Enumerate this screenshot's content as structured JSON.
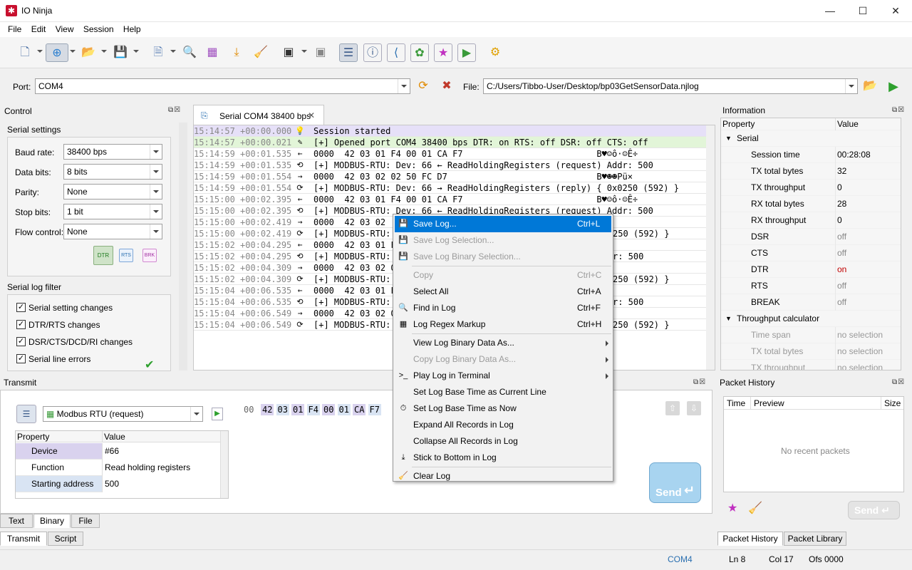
{
  "app": {
    "title": "IO Ninja"
  },
  "menu": [
    "File",
    "Edit",
    "View",
    "Session",
    "Help"
  ],
  "port": {
    "label": "Port:",
    "value": "COM4",
    "file_label": "File:",
    "file_value": "C:/Users/Tibbo-User/Desktop/bp03GetSensorData.njlog"
  },
  "control": {
    "title": "Control",
    "serial_settings": "Serial settings",
    "fields": [
      {
        "label": "Baud rate:",
        "value": "38400 bps"
      },
      {
        "label": "Data bits:",
        "value": "8 bits"
      },
      {
        "label": "Parity:",
        "value": "None"
      },
      {
        "label": "Stop bits:",
        "value": "1 bit"
      },
      {
        "label": "Flow control:",
        "value": "None"
      }
    ],
    "pins": [
      "DTR",
      "RTS",
      "BRK"
    ],
    "filter_title": "Serial log filter",
    "filters": [
      "Serial setting changes",
      "DTR/RTS changes",
      "DSR/CTS/DCD/RI changes",
      "Serial line errors"
    ]
  },
  "session_tab": {
    "label": "Serial COM4 38400 bps"
  },
  "log": [
    {
      "ts": "15:14:57 +00:00.000",
      "icon": "💡",
      "text": "Session started",
      "bg": "#e6e0f8"
    },
    {
      "ts": "15:14:57 +00:00.021",
      "icon": "✎",
      "text": "[+] Opened port COM4 38400 bps DTR: on RTS: off DSR: off CTS: off",
      "bg": "#e2f5d8"
    },
    {
      "ts": "15:14:59 +00:01.535",
      "icon": "←",
      "text": "0000  42 03 01 F4 00 01 CA F7                          B♥☺ô·☺Ê÷",
      "bg": "#ffffff"
    },
    {
      "ts": "15:14:59 +00:01.535",
      "icon": "⟲",
      "text": "[+] MODBUS-RTU: Dev: 66 ← ReadHoldingRegisters (request) Addr: 500",
      "bg": "#ffffff"
    },
    {
      "ts": "15:14:59 +00:01.554",
      "icon": "→",
      "text": "0000  42 03 02 02 50 FC D7                             B♥☻☻Pü×",
      "bg": "#ffffff"
    },
    {
      "ts": "15:14:59 +00:01.554",
      "icon": "⟳",
      "text": "[+] MODBUS-RTU: Dev: 66 → ReadHoldingRegisters (reply) { 0x0250 (592) }",
      "bg": "#ffffff"
    },
    {
      "ts": "15:15:00 +00:02.395",
      "icon": "←",
      "text": "0000  42 03 01 F4 00 01 CA F7                          B♥☺ô·☺Ê÷",
      "bg": "#ffffff"
    },
    {
      "ts": "15:15:00 +00:02.395",
      "icon": "⟲",
      "text": "[+] MODBUS-RTU: Dev: 66 ← ReadHoldingRegisters (request) Addr: 500",
      "bg": "#ffffff"
    },
    {
      "ts": "15:15:00 +00:02.419",
      "icon": "→",
      "text": "0000  42 03 02",
      "bg": "#ffffff"
    },
    {
      "ts": "15:15:00 +00:02.419",
      "icon": "⟳",
      "text": "[+] MODBUS-RTU:",
      "bg": "#ffffff",
      "tail": "250 (592) }"
    },
    {
      "ts": "15:15:02 +00:04.295",
      "icon": "←",
      "text": "0000  42 03 01 F",
      "bg": "#ffffff"
    },
    {
      "ts": "15:15:02 +00:04.295",
      "icon": "⟲",
      "text": "[+] MODBUS-RTU:",
      "bg": "#ffffff",
      "tail": "r: 500"
    },
    {
      "ts": "15:15:02 +00:04.309",
      "icon": "→",
      "text": "0000  42 03 02 0",
      "bg": "#ffffff"
    },
    {
      "ts": "15:15:02 +00:04.309",
      "icon": "⟳",
      "text": "[+] MODBUS-RTU:",
      "bg": "#ffffff",
      "tail": "250 (592) }"
    },
    {
      "ts": "15:15:04 +00:06.535",
      "icon": "←",
      "text": "0000  42 03 01 F",
      "bg": "#ffffff"
    },
    {
      "ts": "15:15:04 +00:06.535",
      "icon": "⟲",
      "text": "[+] MODBUS-RTU:",
      "bg": "#ffffff",
      "tail": "r: 500"
    },
    {
      "ts": "15:15:04 +00:06.549",
      "icon": "→",
      "text": "0000  42 03 02 0",
      "bg": "#ffffff"
    },
    {
      "ts": "15:15:04 +00:06.549",
      "icon": "⟳",
      "text": "[+] MODBUS-RTU:",
      "bg": "#ffffff",
      "tail": "250 (592) }"
    }
  ],
  "context_menu": [
    {
      "label": "Save Log...",
      "shortcut": "Ctrl+L",
      "icon": "💾",
      "state": "selected"
    },
    {
      "label": "Save Log Selection...",
      "shortcut": "",
      "icon": "💾",
      "state": "disabled"
    },
    {
      "label": "Save Log Binary Selection...",
      "shortcut": "",
      "icon": "💾",
      "state": "disabled"
    },
    {
      "sep": true
    },
    {
      "label": "Copy",
      "shortcut": "Ctrl+C",
      "icon": "",
      "state": "disabled"
    },
    {
      "label": "Select All",
      "shortcut": "Ctrl+A",
      "icon": "",
      "state": "normal"
    },
    {
      "label": "Find in Log",
      "shortcut": "Ctrl+F",
      "icon": "🔍",
      "state": "normal"
    },
    {
      "label": "Log Regex Markup",
      "shortcut": "Ctrl+H",
      "icon": "▦",
      "state": "normal"
    },
    {
      "sep": true
    },
    {
      "label": "View Log Binary Data As...",
      "shortcut": "",
      "icon": "",
      "state": "normal",
      "submenu": true
    },
    {
      "label": "Copy Log Binary Data As...",
      "shortcut": "",
      "icon": "",
      "state": "disabled",
      "submenu": true
    },
    {
      "label": "Play Log in Terminal",
      "shortcut": "",
      "icon": ">_",
      "state": "normal",
      "submenu": true
    },
    {
      "label": "Set Log Base Time as Current Line",
      "shortcut": "",
      "icon": "",
      "state": "normal"
    },
    {
      "label": "Set Log Base Time as Now",
      "shortcut": "",
      "icon": "⏱",
      "state": "normal"
    },
    {
      "label": "Expand All Records in Log",
      "shortcut": "",
      "icon": "",
      "state": "normal"
    },
    {
      "label": "Collapse All Records in Log",
      "shortcut": "",
      "icon": "",
      "state": "normal"
    },
    {
      "label": "Stick to Bottom in Log",
      "shortcut": "",
      "icon": "⤓",
      "state": "normal"
    },
    {
      "sep": true
    },
    {
      "label": "Clear Log",
      "shortcut": "",
      "icon": "🧹",
      "state": "normal"
    }
  ],
  "information": {
    "title": "Information",
    "col_property": "Property",
    "col_value": "Value",
    "groups": [
      {
        "name": "Serial",
        "rows": [
          {
            "p": "Session time",
            "v": "00:28:08",
            "color": "#000"
          },
          {
            "p": "TX total bytes",
            "v": "32",
            "color": "#000"
          },
          {
            "p": "TX throughput",
            "v": "0",
            "color": "#000"
          },
          {
            "p": "RX total bytes",
            "v": "28",
            "color": "#000"
          },
          {
            "p": "RX throughput",
            "v": "0",
            "color": "#000"
          },
          {
            "p": "DSR",
            "v": "off",
            "color": "#888"
          },
          {
            "p": "CTS",
            "v": "off",
            "color": "#888"
          },
          {
            "p": "DTR",
            "v": "on",
            "color": "#c00000"
          },
          {
            "p": "RTS",
            "v": "off",
            "color": "#888"
          },
          {
            "p": "BREAK",
            "v": "off",
            "color": "#888"
          }
        ]
      },
      {
        "name": "Throughput calculator",
        "rows": [
          {
            "p": "Time span",
            "v": "no selection",
            "color": "#999"
          },
          {
            "p": "TX total bytes",
            "v": "no selection",
            "color": "#999"
          },
          {
            "p": "TX throughput",
            "v": "no selection",
            "color": "#999"
          }
        ]
      }
    ]
  },
  "transmit": {
    "title": "Transmit",
    "packet_type": "Modbus RTU (request)",
    "col_property": "Property",
    "col_value": "Value",
    "rows": [
      {
        "p": "Device",
        "v": "#66"
      },
      {
        "p": "Function",
        "v": "Read holding registers"
      },
      {
        "p": "Starting address",
        "v": "500"
      }
    ],
    "hex_offset": "00",
    "hex_bytes": [
      "42",
      "03",
      "01",
      "F4",
      "00",
      "01",
      "CA",
      "F7"
    ],
    "send_label": "Send",
    "tabs": [
      "Text",
      "Binary",
      "File"
    ],
    "bottom_tabs": [
      "Transmit",
      "Script"
    ]
  },
  "packet_history": {
    "title": "Packet History",
    "cols": [
      "Time",
      "Preview",
      "Size"
    ],
    "empty": "No recent packets",
    "send_label": "Send",
    "tabs": [
      "Packet History",
      "Packet Library"
    ]
  },
  "status": {
    "port": "COM4",
    "ln": "Ln 8",
    "col": "Col 17",
    "ofs": "Ofs 0000"
  }
}
